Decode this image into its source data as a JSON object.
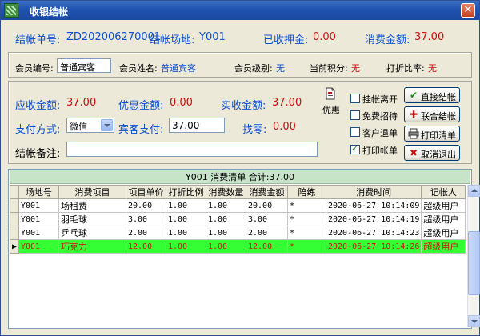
{
  "window": {
    "title": "收银结帐",
    "close_glyph": "✕"
  },
  "summary": {
    "bill_no_label": "结帐单号:",
    "bill_no": "ZD202006270001",
    "venue_label": "结帐场地:",
    "venue": "Y001",
    "deposit_label": "已收押金:",
    "deposit": "0.00",
    "consumed_label": "消费金额:",
    "consumed": "37.00"
  },
  "member": {
    "id_label": "会员编号:",
    "id_value": "普通宾客",
    "name_label": "会员姓名:",
    "name_value": "普通宾客",
    "level_label": "会员级别:",
    "level_value": "无",
    "points_label": "当前积分:",
    "points_value": "无",
    "discount_label": "打折比率:",
    "discount_value": "无"
  },
  "payment": {
    "receivable_label": "应收金额:",
    "receivable": "37.00",
    "discount_label": "优惠金额:",
    "discount": "0.00",
    "actual_label": "实收金额:",
    "actual": "37.00",
    "method_label": "支付方式:",
    "method_value": "微信",
    "guest_pay_label": "宾客支付:",
    "guest_pay_value": "37.00",
    "change_label": "找零:",
    "change": "0.00",
    "note_label": "结帐备注:",
    "note_value": "",
    "promo_label": "优惠",
    "promo_icon": "document-icon"
  },
  "options": [
    {
      "label": "挂帐离开",
      "checked": false
    },
    {
      "label": "免费招待",
      "checked": false
    },
    {
      "label": "客户退单",
      "checked": false
    },
    {
      "label": "打印帐单",
      "checked": true
    }
  ],
  "buttons": {
    "direct_checkout": "直接结帐",
    "joint_checkout": "联合结帐",
    "print_list": "打印清单",
    "cancel_exit": "取消退出"
  },
  "grid": {
    "caption": "Y001 消费清单  合计:37.00",
    "columns": [
      "场地号",
      "消费项目",
      "项目单价",
      "打折比例",
      "消费数量",
      "消费金额",
      "陪练",
      "消费时间",
      "记帐人"
    ],
    "rows": [
      [
        "Y001",
        "场租费",
        "20.00",
        "1.00",
        "1.00",
        "20.00",
        "*",
        "2020-06-27 10:14:09",
        "超级用户"
      ],
      [
        "Y001",
        "羽毛球",
        "3.00",
        "1.00",
        "1.00",
        "3.00",
        "*",
        "2020-06-27 10:14:19",
        "超级用户"
      ],
      [
        "Y001",
        "乒乓球",
        "2.00",
        "1.00",
        "1.00",
        "2.00",
        "*",
        "2020-06-27 10:14:23",
        "超级用户"
      ],
      [
        "Y001",
        "巧克力",
        "12.00",
        "1.00",
        "1.00",
        "12.00",
        "*",
        "2020-06-27 10:14:26",
        "超级用户"
      ]
    ],
    "current_row_marker": "▶"
  },
  "colors": {
    "label_blue": "#0b4fd3",
    "value_red": "#d01010",
    "selected_row": "#33ff33",
    "caption_bg": "#c7e3c8"
  }
}
